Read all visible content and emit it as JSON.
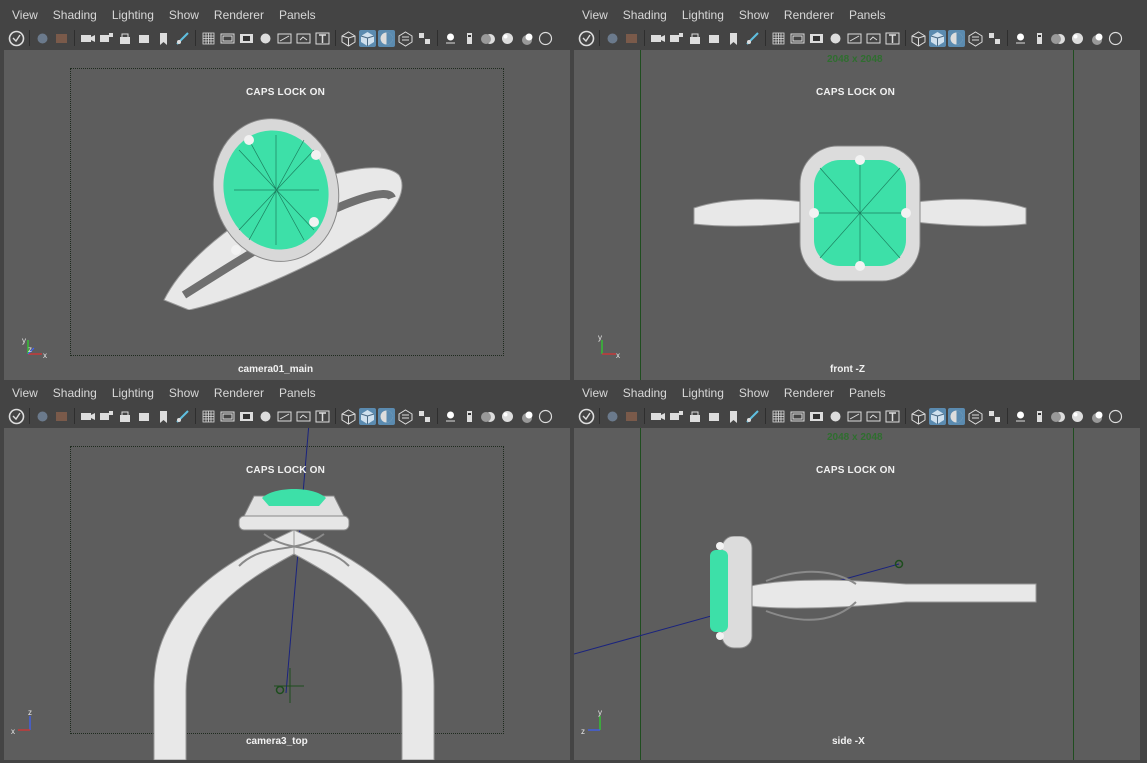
{
  "menus": [
    "View",
    "Shading",
    "Lighting",
    "Show",
    "Renderer",
    "Panels"
  ],
  "panels": {
    "tl": {
      "caps": "CAPS LOCK ON",
      "camera": "camera01_main",
      "resolution": "",
      "axes": [
        "y",
        "z",
        "x"
      ]
    },
    "tr": {
      "caps": "CAPS LOCK ON",
      "camera": "front -Z",
      "resolution": "2048 x 2048",
      "axes": [
        "y",
        "x"
      ]
    },
    "bl": {
      "caps": "CAPS LOCK ON",
      "camera": "camera3_top",
      "resolution": "",
      "axes": [
        "z",
        "x"
      ]
    },
    "br": {
      "caps": "CAPS LOCK ON",
      "camera": "side -X",
      "resolution": "2048 x 2048",
      "axes": [
        "y",
        "z"
      ]
    }
  },
  "toolbar_icons": [
    "maya-logo-icon",
    "select-camera-icon",
    "camera-attributes-icon",
    "bookmarks-icon",
    "image-plane-icon",
    "lock-camera-icon",
    "camera-attrs2-icon",
    "grease-pencil-icon",
    "film-gate-icon",
    "grid-icon",
    "resolution-gate-icon",
    "gate-mask-icon",
    "field-chart-icon",
    "safe-action-icon",
    "safe-title-icon",
    "text-icon",
    "wireframe-icon",
    "smooth-shade-icon",
    "wireframe-on-shaded-icon",
    "textured-icon",
    "use-all-lights-icon",
    "shadows-icon",
    "screen-space-ao-icon",
    "motion-blur-icon",
    "anti-aliasing-icon",
    "isolate-select-icon",
    "xray-icon"
  ],
  "colors": {
    "viewport_bg": "#5d5d5d",
    "chrome_bg": "#444444",
    "gem": "#3de0a8",
    "metal": "#e6e6e6",
    "highlight": "#5b8bb0"
  }
}
